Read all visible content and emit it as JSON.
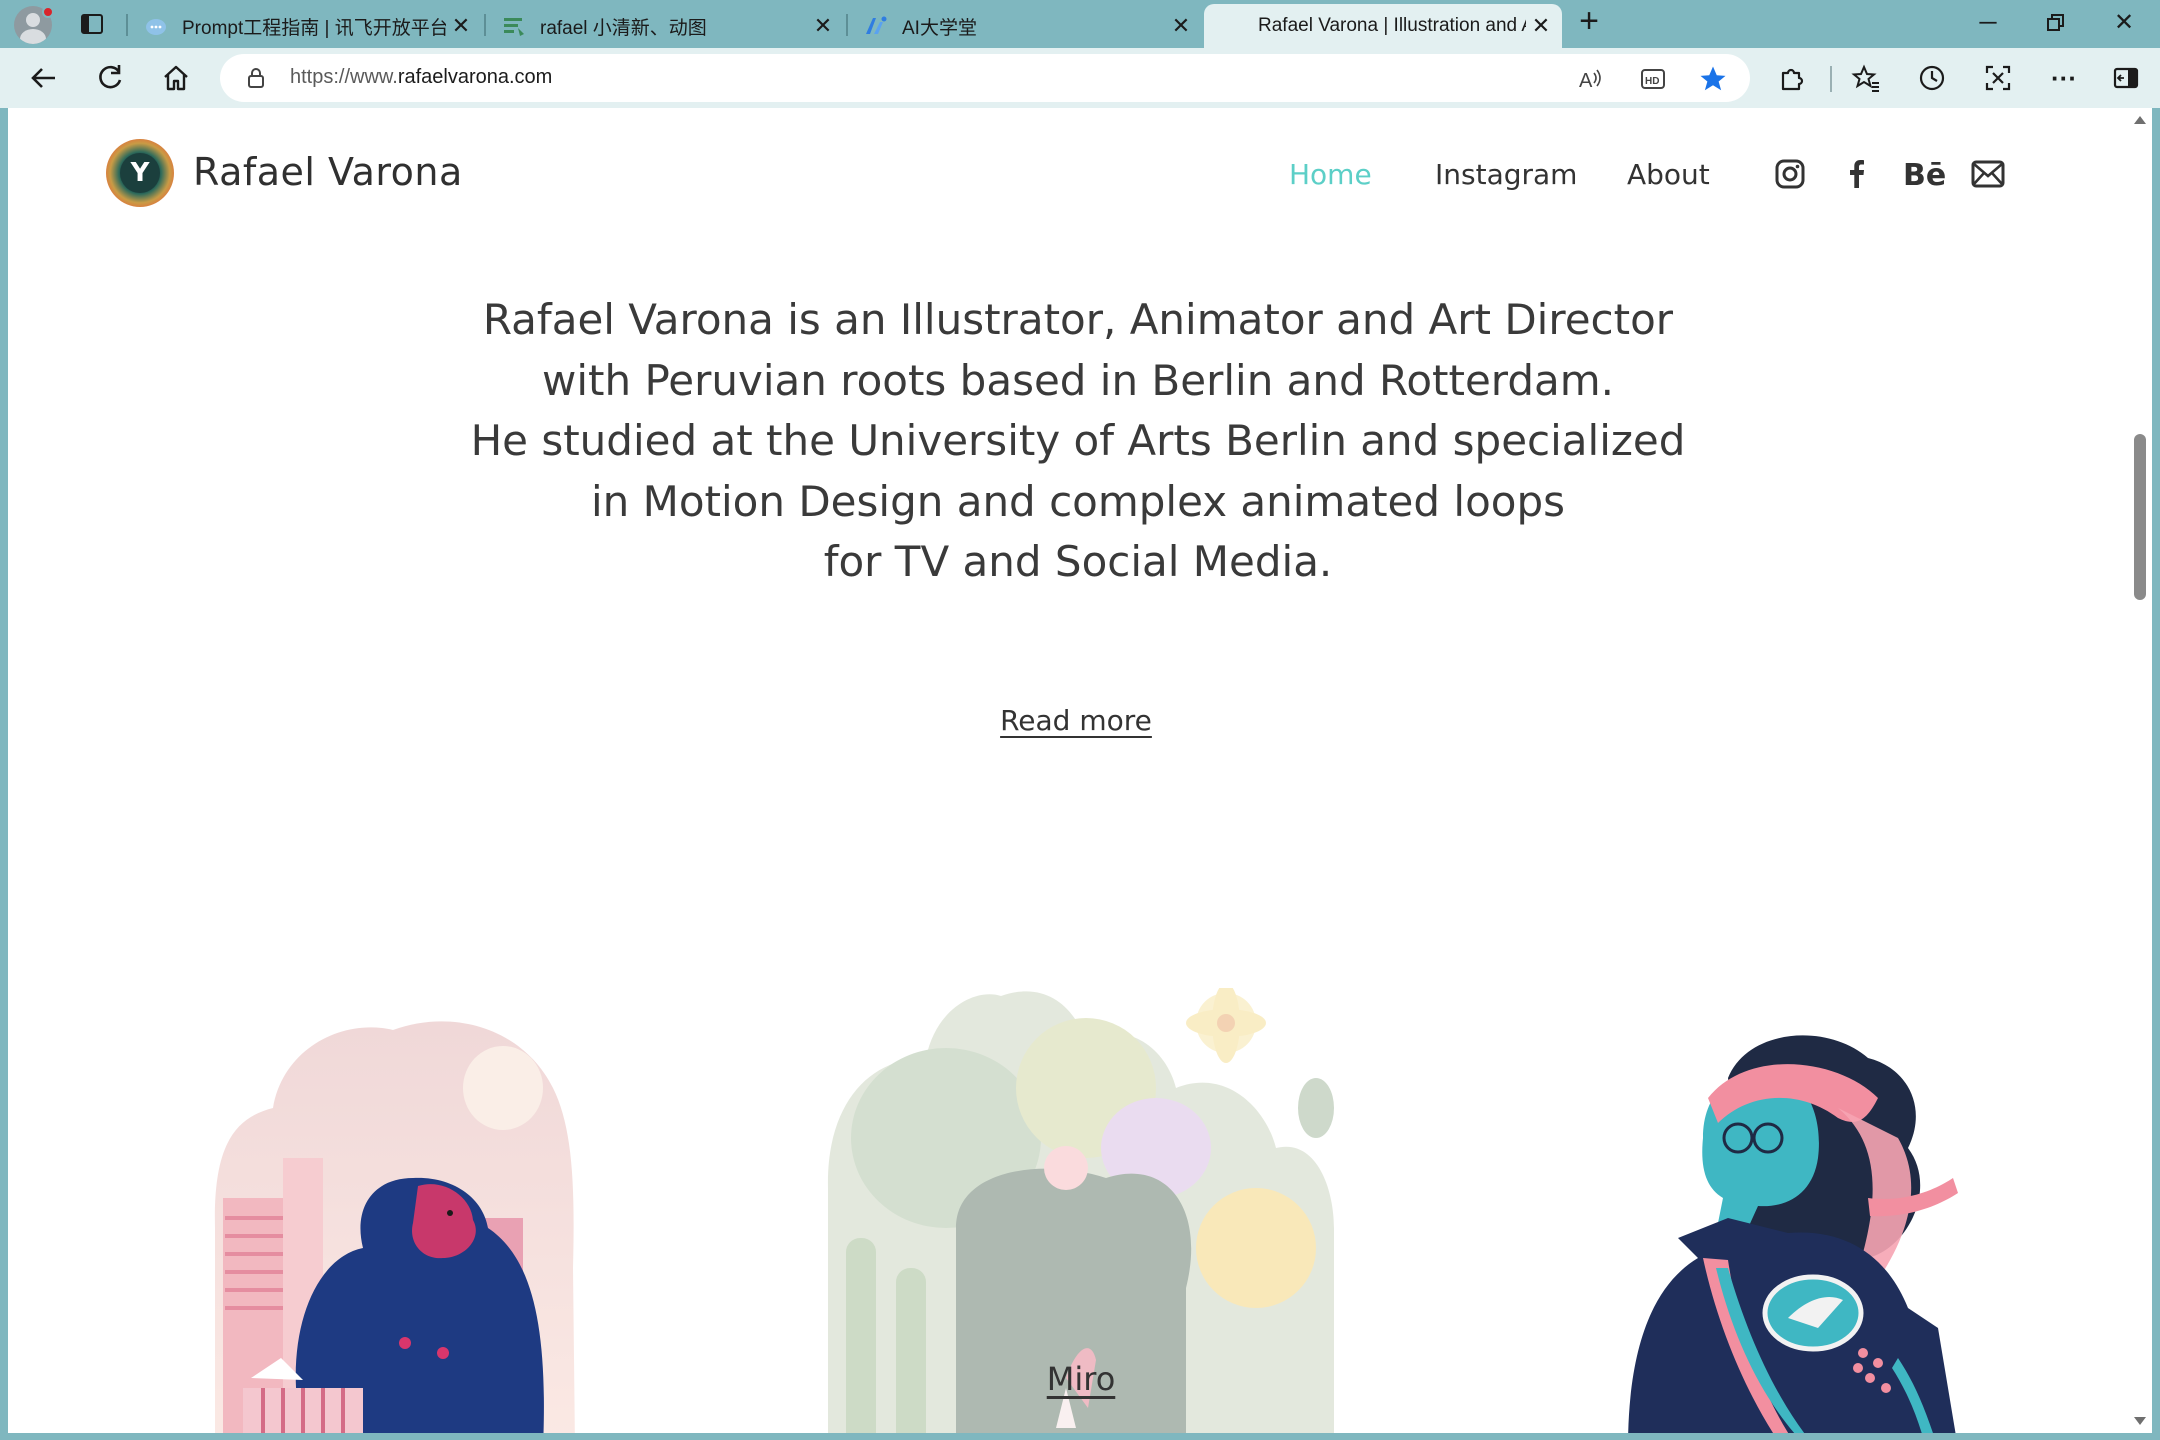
{
  "browser": {
    "tabs": [
      {
        "title": "Prompt工程指南 | 讯飞开放平台",
        "favicon": "cloud-chat-icon"
      },
      {
        "title": "rafael 小清新、动图",
        "favicon": "text-lines-icon"
      },
      {
        "title": "AI大学堂",
        "favicon": "ai-school-icon"
      },
      {
        "title": "Rafael Varona | Illustration and Animation",
        "favicon": "none",
        "active": true
      }
    ],
    "address": {
      "url_prefix": "https://www.",
      "url_domain": "rafaelvarona.com"
    }
  },
  "site": {
    "title": "Rafael Varona",
    "logo_letter": "Y",
    "nav": [
      {
        "label": "Home",
        "active": true
      },
      {
        "label": "Instagram"
      },
      {
        "label": "About"
      }
    ],
    "social": [
      "instagram-icon",
      "facebook-icon",
      "behance-icon",
      "mail-icon"
    ],
    "intro_lines": [
      "Rafael Varona is an Illustrator, Animator and Art Director",
      "with Peruvian roots based in Berlin and Rotterdam.",
      "He studied at the University of Arts Berlin and specialized",
      "in Motion Design and complex animated loops",
      "for TV and Social Media."
    ],
    "read_more": "Read more",
    "gallery": [
      {
        "caption": "",
        "subject": "gorilla-with-shopping-bag"
      },
      {
        "caption": "Miro",
        "subject": "jungle-plants-and-parrot"
      },
      {
        "caption": "",
        "subject": "woman-in-jacket-with-pink-headband"
      }
    ]
  },
  "colors": {
    "accent": "#5ccfc7",
    "text": "#333333",
    "browser_frame": "#7fb7bf",
    "toolbar": "#e3f0f1",
    "star": "#1a73e8"
  }
}
